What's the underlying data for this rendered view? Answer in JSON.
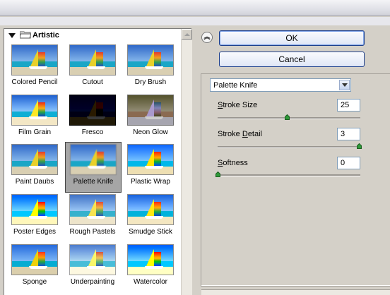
{
  "gallery": {
    "category": "Artistic",
    "thumbnails": [
      {
        "label": "Colored Pencil",
        "selected": false
      },
      {
        "label": "Cutout",
        "selected": false
      },
      {
        "label": "Dry Brush",
        "selected": false
      },
      {
        "label": "Film Grain",
        "selected": false
      },
      {
        "label": "Fresco",
        "selected": false
      },
      {
        "label": "Neon Glow",
        "selected": false
      },
      {
        "label": "Paint Daubs",
        "selected": false
      },
      {
        "label": "Palette Knife",
        "selected": true
      },
      {
        "label": "Plastic Wrap",
        "selected": false
      },
      {
        "label": "Poster Edges",
        "selected": false
      },
      {
        "label": "Rough Pastels",
        "selected": false
      },
      {
        "label": "Smudge Stick",
        "selected": false
      },
      {
        "label": "Sponge",
        "selected": false
      },
      {
        "label": "Underpainting",
        "selected": false
      },
      {
        "label": "Watercolor",
        "selected": false
      }
    ]
  },
  "buttons": {
    "ok": "OK",
    "cancel": "Cancel"
  },
  "filter_select": {
    "value": "Palette Knife"
  },
  "params": [
    {
      "label_pre": "",
      "accel": "S",
      "label_post": "troke Size",
      "value": "25",
      "level": 0.49
    },
    {
      "label_pre": "Stroke ",
      "accel": "D",
      "label_post": "etail",
      "value": "3",
      "level": 1.0
    },
    {
      "label_pre": "",
      "accel": "S",
      "label_post": "oftness",
      "value": "0",
      "level": 0.0
    }
  ],
  "colors": {
    "selected_thumb_bg": "#a6a6a6",
    "button_border": "#1d3f8c",
    "field_border": "#7f9db9"
  }
}
